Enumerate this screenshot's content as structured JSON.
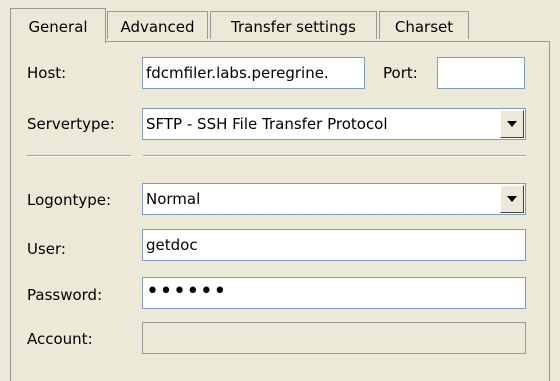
{
  "tabs": [
    {
      "label": "General",
      "active": true
    },
    {
      "label": "Advanced",
      "active": false
    },
    {
      "label": "Transfer settings",
      "active": false
    },
    {
      "label": "Charset",
      "active": false
    }
  ],
  "form": {
    "host_label": "Host:",
    "host_value": "fdcmfiler.labs.peregrine.",
    "port_label": "Port:",
    "port_value": "",
    "servertype_label": "Servertype:",
    "servertype_value": "SFTP - SSH File Transfer Protocol",
    "logontype_label": "Logontype:",
    "logontype_value": "Normal",
    "user_label": "User:",
    "user_value": "getdoc",
    "password_label": "Password:",
    "password_value": "••••••",
    "account_label": "Account:",
    "account_value": ""
  },
  "icons": {
    "dropdown": "chevron-down-icon"
  },
  "colors": {
    "background": "#ece9d8",
    "field_border": "#7f9db9",
    "tab_border": "#919b9c"
  }
}
